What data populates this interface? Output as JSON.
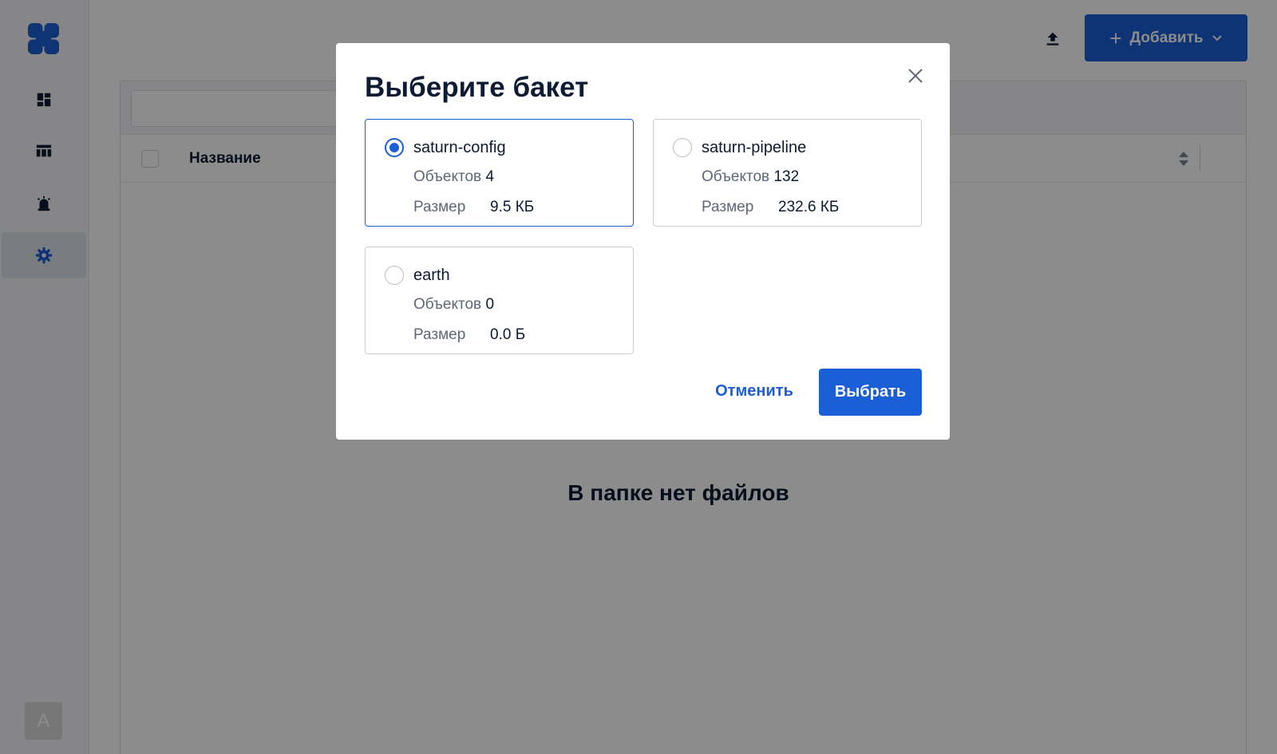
{
  "sidebar": {
    "avatar_letter": "A",
    "items": [
      {
        "name": "dashboard"
      },
      {
        "name": "table"
      },
      {
        "name": "alarm"
      },
      {
        "name": "settings",
        "active": true
      }
    ]
  },
  "header": {
    "add_button_label": "Добавить"
  },
  "table": {
    "column_name": "Название",
    "empty_message": "В папке нет файлов"
  },
  "modal": {
    "title": "Выберите бакет",
    "objects_label": "Объектов",
    "size_label": "Размер",
    "buckets": [
      {
        "name": "saturn-config",
        "objects": "4",
        "size": "9.5 КБ",
        "selected": true
      },
      {
        "name": "saturn-pipeline",
        "objects": "132",
        "size": "232.6 КБ",
        "selected": false
      },
      {
        "name": "earth",
        "objects": "0",
        "size": "0.0 Б",
        "selected": false
      }
    ],
    "cancel_label": "Отменить",
    "select_label": "Выбрать"
  },
  "colors": {
    "accent": "#1a5fd6",
    "text": "#0d1b33",
    "muted": "#5f6877"
  }
}
